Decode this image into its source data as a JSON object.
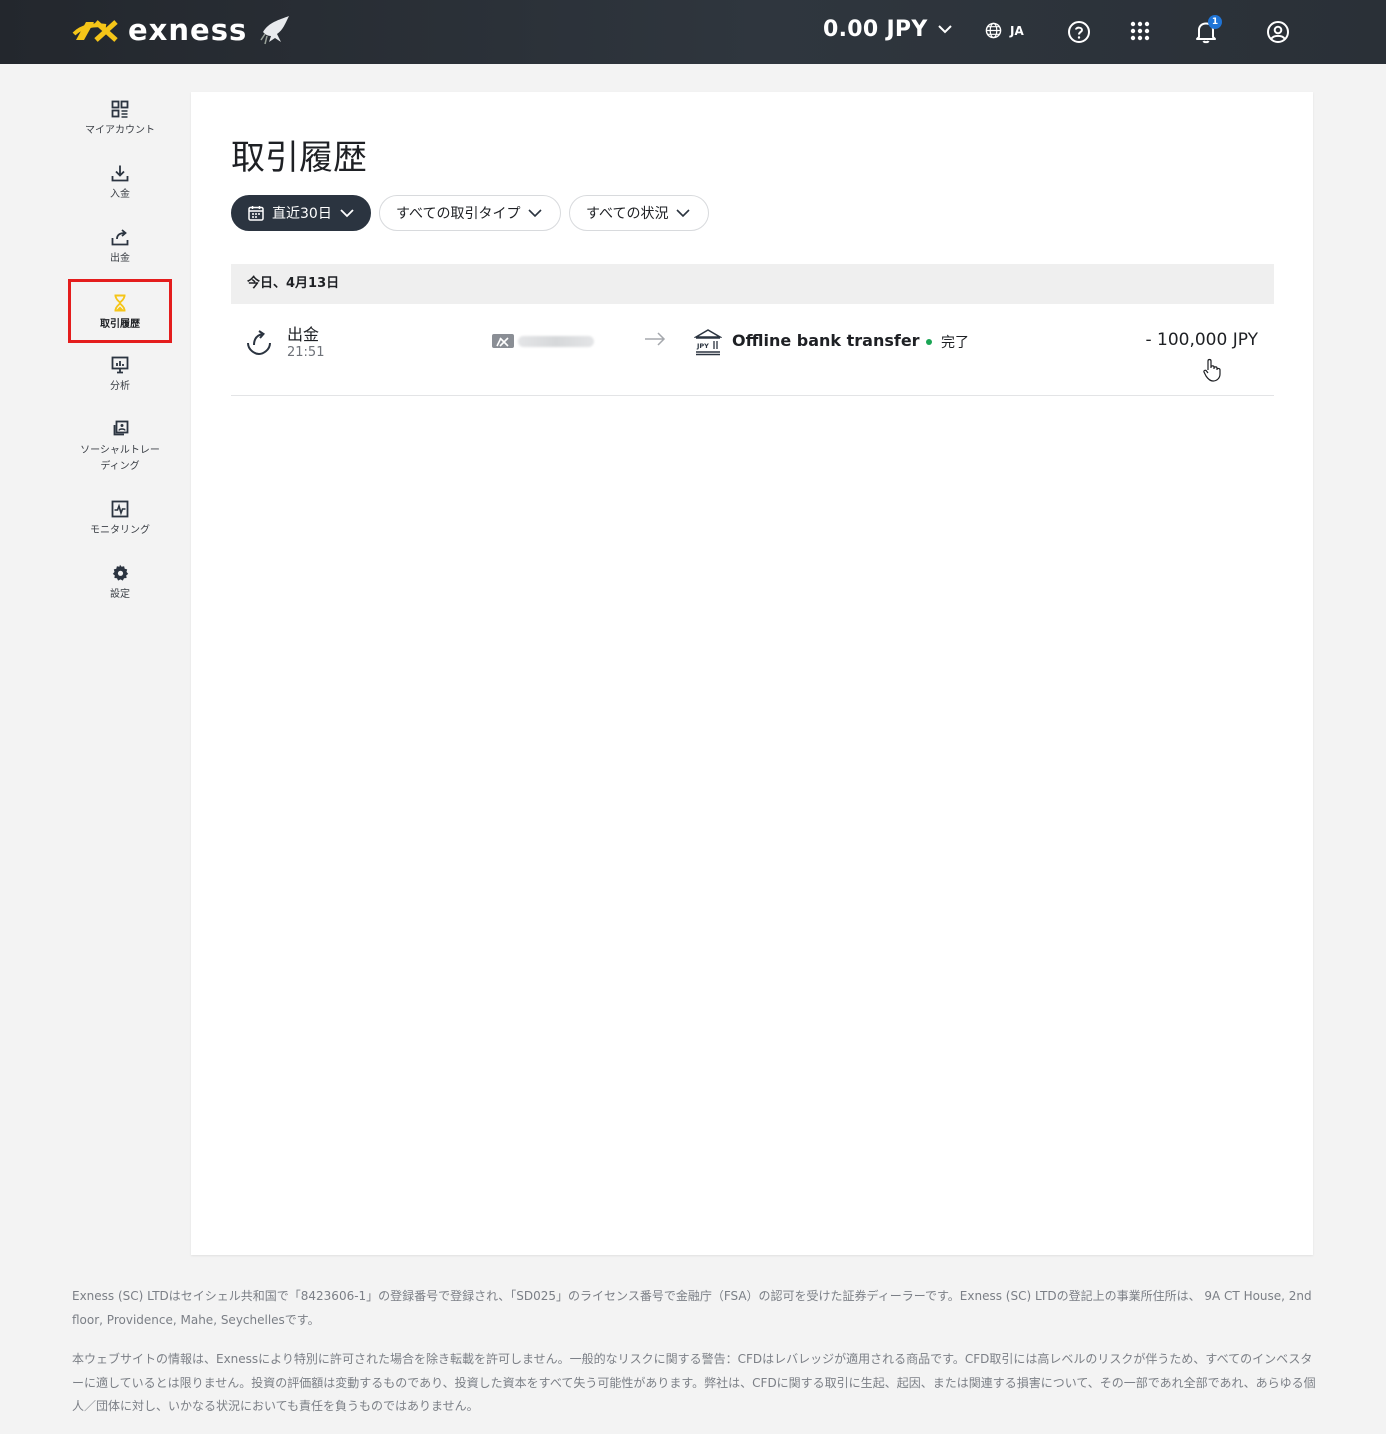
{
  "header": {
    "brand": "exness",
    "balance": "0.00 JPY",
    "language": "JA",
    "notification_count": "1"
  },
  "sidebar": {
    "items": [
      {
        "label": "マイアカウント",
        "icon": "dashboard-icon"
      },
      {
        "label": "入金",
        "icon": "download-icon"
      },
      {
        "label": "出金",
        "icon": "upload-share-icon"
      },
      {
        "label": "取引履歴",
        "icon": "hourglass-icon",
        "active": true
      },
      {
        "label": "分析",
        "icon": "presentation-chart-icon"
      },
      {
        "label": "ソーシャルトレーディング",
        "icon": "copy-trading-icon"
      },
      {
        "label": "モニタリング",
        "icon": "activity-chart-icon"
      },
      {
        "label": "設定",
        "icon": "gear-icon"
      }
    ]
  },
  "main": {
    "title": "取引履歴",
    "filters": {
      "period": "直近30日",
      "type": "すべての取引タイプ",
      "status": "すべての状況"
    },
    "group_date": "今日、4月13日",
    "transactions": [
      {
        "type": "出金",
        "time": "21:51",
        "destination": "Offline bank transfer",
        "bank_badge": "JPY",
        "status": "完了",
        "amount": "- 100,000 JPY"
      }
    ]
  },
  "footer": {
    "line1": "Exness (SC) LTDはセイシェル共和国で「8423606-1」の登録番号で登録され、「SD025」のライセンス番号で金融庁（FSA）の認可を受けた証券ディーラーです。Exness (SC) LTDの登記上の事業所住所は、 9A CT House, 2nd floor, Providence, Mahe, Seychellesです。",
    "line2": "本ウェブサイトの情報は、Exnessにより特別に許可された場合を除き転載を許可しません。一般的なリスクに関する警告：CFDはレバレッジが適用される商品です。CFD取引には高レベルのリスクが伴うため、すべてのインベスターに適しているとは限りません。投資の評価額は変動するものであり、投資した資本をすべて失う可能性があります。弊社は、CFDに関する取引に生起、起因、または関連する損害について、その一部であれ全部であれ、あらゆる個人／団体に対し、いかなる状況においても責任を負うものではありません。"
  },
  "colors": {
    "header_bg": "#2a3037",
    "brand_yellow": "#f5c518",
    "active_outline": "#e41d1d",
    "status_success": "#1aa555",
    "badge_blue": "#1f74d6"
  }
}
